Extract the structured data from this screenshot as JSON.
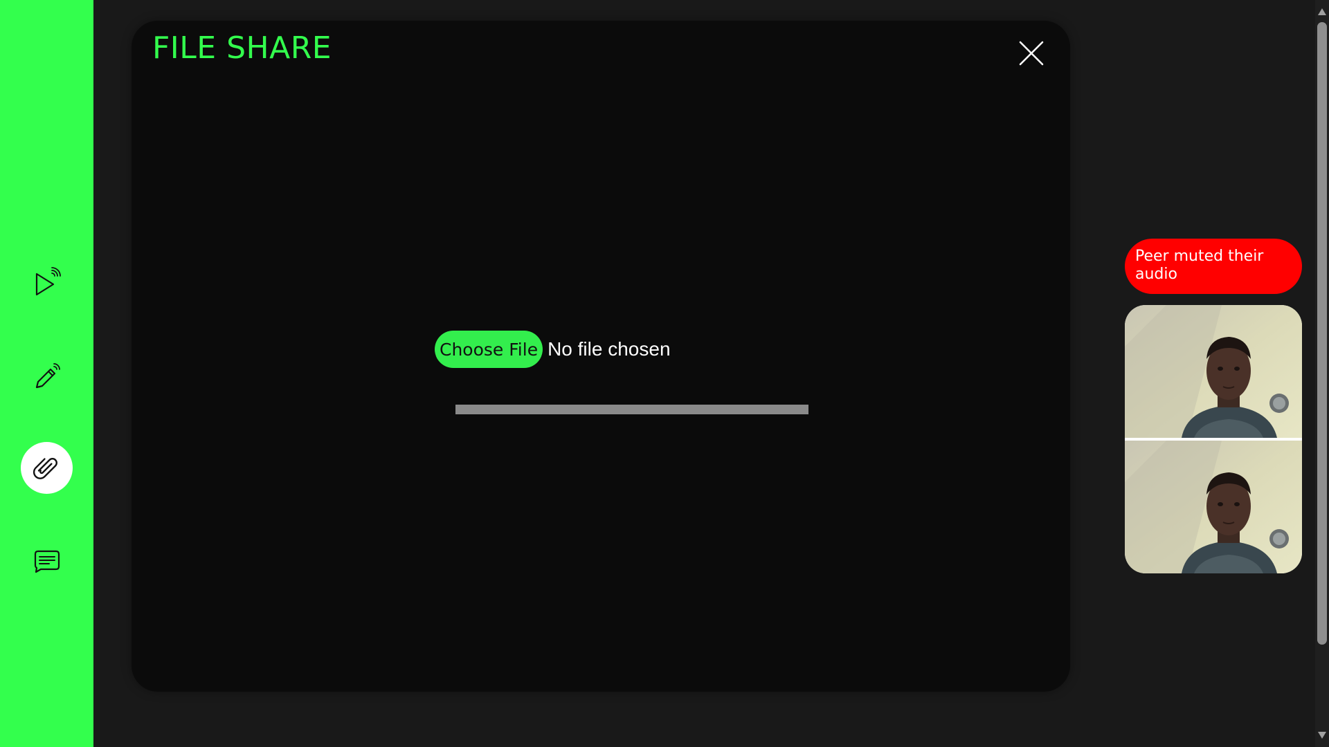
{
  "sidebar": {
    "items": [
      {
        "name": "broadcast-video",
        "icon": "play-broadcast-icon"
      },
      {
        "name": "whiteboard",
        "icon": "pen-broadcast-icon"
      },
      {
        "name": "file-share",
        "icon": "paperclip-icon",
        "active": true
      },
      {
        "name": "chat",
        "icon": "message-icon"
      }
    ],
    "bg_color": "#33ff4d"
  },
  "modal": {
    "title": "FILE SHARE",
    "close_icon": "close-icon",
    "choose_file_label": "Choose File",
    "file_status": "No file chosen",
    "progress": 0
  },
  "notification": {
    "text": "Peer muted their audio",
    "color": "#ff0000"
  },
  "videos": {
    "tiles": 2
  },
  "colors": {
    "accent": "#33ff4d",
    "background": "#191919",
    "modal": "#0b0b0b",
    "progress_track": "#8a8a8a"
  }
}
